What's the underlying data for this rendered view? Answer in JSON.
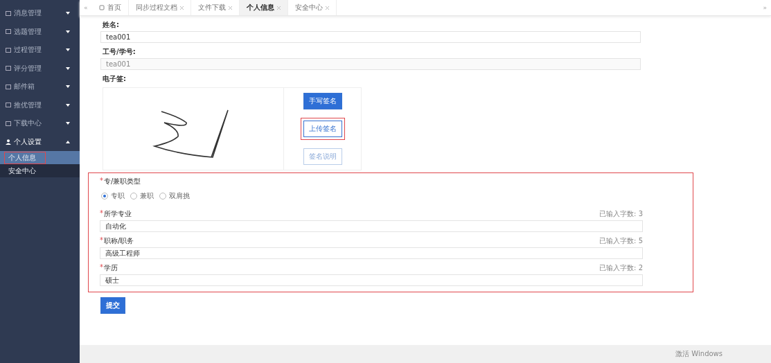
{
  "sidebar": {
    "items": [
      {
        "label": "消息管理",
        "expanded": false
      },
      {
        "label": "选题管理",
        "expanded": false
      },
      {
        "label": "过程管理",
        "expanded": false
      },
      {
        "label": "评分管理",
        "expanded": false
      },
      {
        "label": "邮件箱",
        "expanded": false
      },
      {
        "label": "推优管理",
        "expanded": false
      },
      {
        "label": "下载中心",
        "expanded": false
      },
      {
        "label": "个人设置",
        "expanded": true,
        "children": [
          {
            "label": "个人信息",
            "selected": true,
            "highlighted": true
          },
          {
            "label": "安全中心",
            "selected": false,
            "highlighted": false
          }
        ]
      }
    ]
  },
  "tabs": [
    {
      "label": "首页",
      "kind": "home",
      "selected": false
    },
    {
      "label": "同步过程文档",
      "kind": "closable",
      "selected": false
    },
    {
      "label": "文件下载",
      "kind": "closable",
      "selected": false
    },
    {
      "label": "个人信息",
      "kind": "closable",
      "selected": true
    },
    {
      "label": "安全中心",
      "kind": "closable",
      "selected": false
    }
  ],
  "tab_nav": {
    "prev": "«",
    "next": "»"
  },
  "fields": [
    {
      "label": "姓名:",
      "value": "tea001",
      "disabled": false
    },
    {
      "label": "工号/学号:",
      "value": "tea001",
      "disabled": true
    }
  ],
  "signature": {
    "label": "电子签:",
    "buttons": [
      {
        "label": "手写签名",
        "kind": "primary",
        "highlighted": false
      },
      {
        "label": "上传签名",
        "kind": "outline",
        "highlighted": true
      },
      {
        "label": "签名说明",
        "kind": "muted",
        "highlighted": false
      }
    ]
  },
  "section": {
    "highlighted": true,
    "required_mark": "*",
    "type_field": {
      "label": "专/兼职类型",
      "options": [
        {
          "label": "专职",
          "selected": true
        },
        {
          "label": "兼职",
          "selected": false
        },
        {
          "label": "双肩挑",
          "selected": false
        }
      ]
    },
    "text_fields": [
      {
        "label": "所学专业",
        "value": "自动化",
        "count": "已输入字数: 3"
      },
      {
        "label": "职称/职务",
        "value": "高级工程师",
        "count": "已输入字数: 5"
      },
      {
        "label": "学历",
        "value": "硕士",
        "count": "已输入字数: 2"
      }
    ]
  },
  "submit": "提交",
  "os_watermark": "激活 Windows"
}
